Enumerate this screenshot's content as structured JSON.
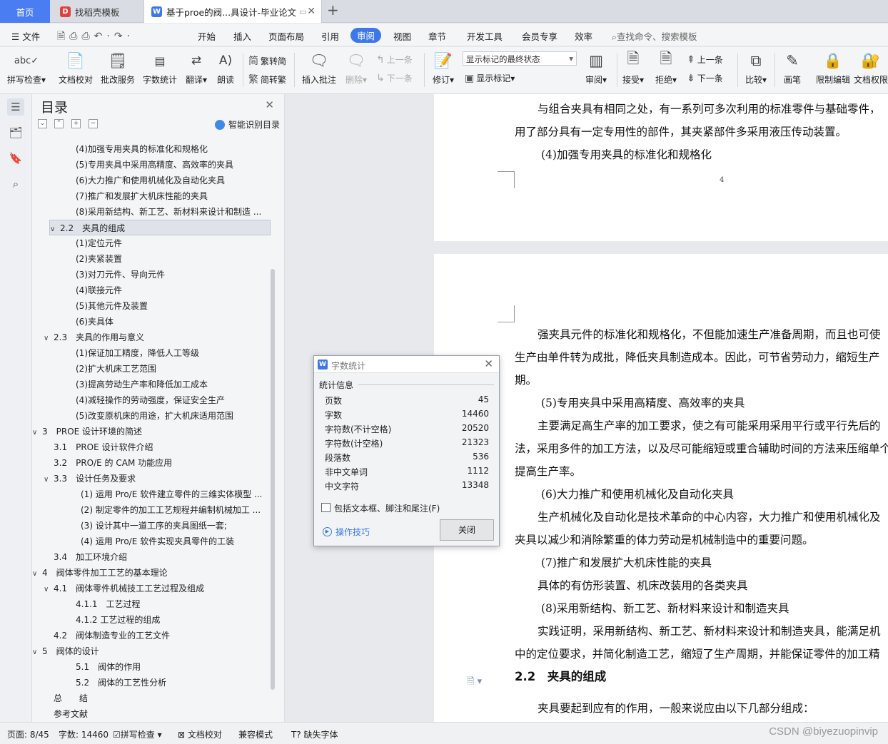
{
  "tabs": {
    "home": "首页",
    "template": "找稻壳模板",
    "doc": "基于proe的阀...具设计-毕业论文"
  },
  "menu": {
    "file": "文件",
    "items": [
      "开始",
      "插入",
      "页面布局",
      "引用",
      "审阅",
      "视图",
      "章节",
      "开发工具",
      "会员专享",
      "效率"
    ],
    "search": "查找命令、搜索模板"
  },
  "ribbon": {
    "spell": "拼写检查",
    "proof": "文档校对",
    "batch": "批改服务",
    "wordcount": "字数统计",
    "translate": "翻译",
    "read": "朗读",
    "t2s": "繁转简",
    "s2t": "简转繁",
    "insert_comment": "插入批注",
    "delete": "删除",
    "prev": "上一条",
    "next": "下一条",
    "revise": "修订",
    "markup_state": "显示标记的最终状态",
    "show_markup": "显示标记",
    "review": "审阅",
    "accept": "接受",
    "reject": "拒绝",
    "prev2": "上一条",
    "next2": "下一条",
    "compare": "比较",
    "pen": "画笔",
    "restrict": "限制编辑",
    "perm": "文档权限"
  },
  "toc": {
    "title": "目录",
    "smart": "智能识别目录",
    "items": [
      {
        "t": "(4)加强专用夹具的标准化和规格化",
        "lvl": 3
      },
      {
        "t": "(5)专用夹具中采用高精度、高效率的夹具",
        "lvl": 3
      },
      {
        "t": "(6)大力推广和使用机械化及自动化夹具",
        "lvl": 3
      },
      {
        "t": "(7)推广和发展扩大机床性能的夹具",
        "lvl": 3
      },
      {
        "t": "(8)采用新结构、新工艺、新材料来设计和制造 ...",
        "lvl": 3
      },
      {
        "t": "2.2　夹具的组成",
        "lvl": 2,
        "caret": true,
        "sel": true
      },
      {
        "t": "(1)定位元件",
        "lvl": 3
      },
      {
        "t": "(2)夹紧装置",
        "lvl": 3
      },
      {
        "t": "(3)对刀元件、导向元件",
        "lvl": 3
      },
      {
        "t": "(4)联接元件",
        "lvl": 3
      },
      {
        "t": "(5)其他元件及装置",
        "lvl": 3
      },
      {
        "t": "(6)夹具体",
        "lvl": 3
      },
      {
        "t": "2.3　夹具的作用与意义",
        "lvl": 2,
        "caret": true
      },
      {
        "t": "(1)保证加工精度，降低人工等级",
        "lvl": 3
      },
      {
        "t": "(2)扩大机床工艺范围",
        "lvl": 3
      },
      {
        "t": "(3)提高劳动生产率和降低加工成本",
        "lvl": 3
      },
      {
        "t": "(4)减轻操作的劳动强度，保证安全生产",
        "lvl": 3
      },
      {
        "t": "(5)改变原机床的用途，扩大机床适用范围",
        "lvl": 3
      },
      {
        "t": "3　PROE 设计环境的简述",
        "lvl": 1,
        "caret": true
      },
      {
        "t": "3.1　PROE 设计软件介绍",
        "lvl": 2
      },
      {
        "t": "3.2　PRO/E 的 CAM 功能应用",
        "lvl": 2
      },
      {
        "t": "3.3　设计任务及要求",
        "lvl": 2,
        "caret": true
      },
      {
        "t": "(1) 运用 Pro/E 软件建立零件的三维实体模型 ...",
        "lvl": 4
      },
      {
        "t": "(2) 制定零件的加工工艺规程并编制机械加工 ...",
        "lvl": 4
      },
      {
        "t": "(3) 设计其中一道工序的夹具图纸一套;",
        "lvl": 4
      },
      {
        "t": "(4) 运用 Pro/E 软件实现夹具零件的工装",
        "lvl": 4
      },
      {
        "t": "3.4　加工环境介绍",
        "lvl": 2
      },
      {
        "t": "4　阀体零件加工工艺的基本理论",
        "lvl": 1,
        "caret": true
      },
      {
        "t": "4.1　阀体零件机械技工工艺过程及组成",
        "lvl": 2,
        "caret": true
      },
      {
        "t": "4.1.1　工艺过程",
        "lvl": 3
      },
      {
        "t": "4.1.2 工艺过程的组成",
        "lvl": 3
      },
      {
        "t": "4.2　阀体制造专业的工艺文件",
        "lvl": 2
      },
      {
        "t": "5　阀体的设计",
        "lvl": 1,
        "caret": true
      },
      {
        "t": "5.1　阀体的作用",
        "lvl": 3
      },
      {
        "t": "5.2　阀体的工艺性分析",
        "lvl": 3
      },
      {
        "t": "总　　结",
        "lvl": 0
      },
      {
        "t": "参考文献",
        "lvl": 0
      }
    ]
  },
  "page1": {
    "lines": [
      "与组合夹具有相同之处，有一系列可多次利用的标准零件与基础零件，",
      "用了部分具有一定专用性的部件，其夹紧部件多采用液压传动装置。",
      "(4)加强专用夹具的标准化和规格化"
    ],
    "page_no": "4"
  },
  "page2": {
    "lines": [
      "强夹具元件的标准化和规格化，不但能加速生产准备周期，而且也可使",
      "生产由单件转为成批，降低夹具制造成本。因此，可节省劳动力，缩短生产",
      "期。",
      "(5)专用夹具中采用高精度、高效率的夹具",
      "主要满足高生产率的加工要求，使之有可能采用采用平行或平行先后的",
      "法，采用多件的加工方法，以及尽可能缩短或重合辅助时间的方法来压缩单个",
      "提高生产率。",
      "(6)大力推广和使用机械化及自动化夹具",
      "生产机械化及自动化是技术革命的中心内容，大力推广和使用机械化及",
      "夹具以减少和消除繁重的体力劳动是机械制造中的重要问题。",
      "(7)推广和发展扩大机床性能的夹具",
      "具体的有仿形装置、机床改装用的各类夹具",
      "(8)采用新结构、新工艺、新材料来设计和制造夹具",
      "实践证明，采用新结构、新工艺、新材料来设计和制造夹具，能满足机",
      "中的定位要求，并简化制造工艺，缩短了生产周期，并能保证零件的加工精",
      "2.2　夹具的组成",
      "夹具要起到应有的作用，一般来说应由以下几部分组成："
    ]
  },
  "dialog": {
    "title": "字数统计",
    "section": "统计信息",
    "stats": [
      {
        "k": "页数",
        "v": "45"
      },
      {
        "k": "字数",
        "v": "14460"
      },
      {
        "k": "字符数(不计空格)",
        "v": "20520"
      },
      {
        "k": "字符数(计空格)",
        "v": "21323"
      },
      {
        "k": "段落数",
        "v": "536"
      },
      {
        "k": "非中文单词",
        "v": "1112"
      },
      {
        "k": "中文字符",
        "v": "13348"
      }
    ],
    "checkbox": "包括文本框、脚注和尾注(F)",
    "tips": "操作技巧",
    "close": "关闭"
  },
  "status": {
    "page": "页面: 8/45",
    "words": "字数: 14460",
    "spell": "拼写检查",
    "proof": "文档校对",
    "compat": "兼容模式",
    "missing_font": "缺失字体",
    "watermark": "CSDN @biyezuopinvip"
  }
}
